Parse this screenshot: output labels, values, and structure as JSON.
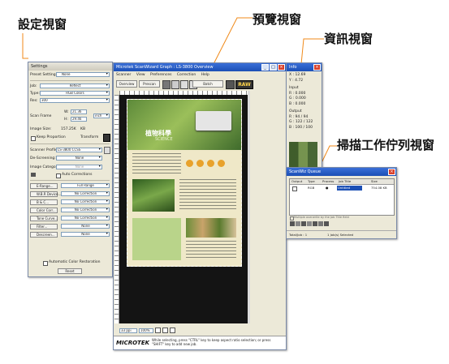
{
  "callouts": {
    "settings": "設定視窗",
    "preview": "預覽視窗",
    "info": "資訊視窗",
    "queue": "掃描工作佇列視窗"
  },
  "settings_window": {
    "title": "Settings",
    "preset_label": "Preset Setting:",
    "preset_value": "None",
    "job_label": "Job:",
    "job_value": "Reflect",
    "type_label": "Type:",
    "type_value": "RGB Colors",
    "res_label": "Res:",
    "res_value": "300",
    "w_label": "W:",
    "w_value": "21.36",
    "h_label": "H:",
    "h_value": "29.46",
    "unit_value": "inch",
    "scan_frame_label": "Scan Frame",
    "image_size_label": "Image Size:",
    "image_size_value": "157.25K",
    "image_size_unit": "KB",
    "keep_proportion": "Keep Proportion",
    "transform": "Transform",
    "scanner_profile_label": "Scanner Profile",
    "scanner_profile_value": "LS-3800 CCSS",
    "descreening_label": "De-Screening:",
    "descreening_value": "None",
    "image_category_label": "Image Category:",
    "image_category_value": "None",
    "auto_corrections": "Auto Corrections",
    "tools": [
      {
        "label": "E-Range...",
        "value": "Full Range"
      },
      {
        "label": "W.B.R Device...",
        "value": "No Correction"
      },
      {
        "label": "B & C...",
        "value": "No Correction"
      },
      {
        "label": "Color Corr...",
        "value": "No Correction"
      },
      {
        "label": "Tone Curve...",
        "value": "No Correction"
      },
      {
        "label": "Filter...",
        "value": "None"
      },
      {
        "label": "Descreen...",
        "value": "None"
      }
    ],
    "auto_color_restoration": "Automatic Color Restoration",
    "reset_button": "Reset"
  },
  "preview_window": {
    "title": "Microtek ScanWizard Graph : LS-3800 Overview",
    "menu": [
      "Scanner",
      "View",
      "Preferences",
      "Correction",
      "Help"
    ],
    "overview_button": "Overview",
    "prescan_button": "Prescan",
    "batch_button": "Batch",
    "raw_label": "RAW",
    "doc_title": "植物科學",
    "doc_subtitle": "SCIENCE",
    "zoom_value": "33 ppi",
    "zoom_percent": "100%",
    "brand": "MICROTEK",
    "status_text": "While selecting, press \"CTRL\" key to keep aspect ratio selection; or press \"SHIFT\" key to add new job."
  },
  "info_window": {
    "title": "Info",
    "x_label": "X",
    "x_value": "12.69",
    "y_label": "Y",
    "y_value": "4.72",
    "input_label": "Input",
    "input_r": "R : 0.000",
    "input_g": "G : 0.000",
    "input_b": "B : 0.000",
    "output_label": "Output",
    "output_r": "R : 94  /  94",
    "output_g": "G : 122 / 122",
    "output_b": "B : 100 / 100"
  },
  "queue_window": {
    "title": "ScanWiz Queue",
    "columns": [
      "Output",
      "Type",
      "Process",
      "Job Title",
      "Size"
    ],
    "row": {
      "output": "",
      "type": "RGB",
      "process": "",
      "job_title": "Untitled",
      "size": "754.08 KB"
    },
    "option_label": "Multiple overwrite by the Job Title field",
    "footer_left": "Total/Job : 1",
    "footer_right": "1 Job(s) Selected"
  },
  "colors": {
    "accent": "#1b4fb5",
    "callout_line": "#f08a1a",
    "document_green": "#6b8e3a",
    "scan_bed": "#141414"
  }
}
